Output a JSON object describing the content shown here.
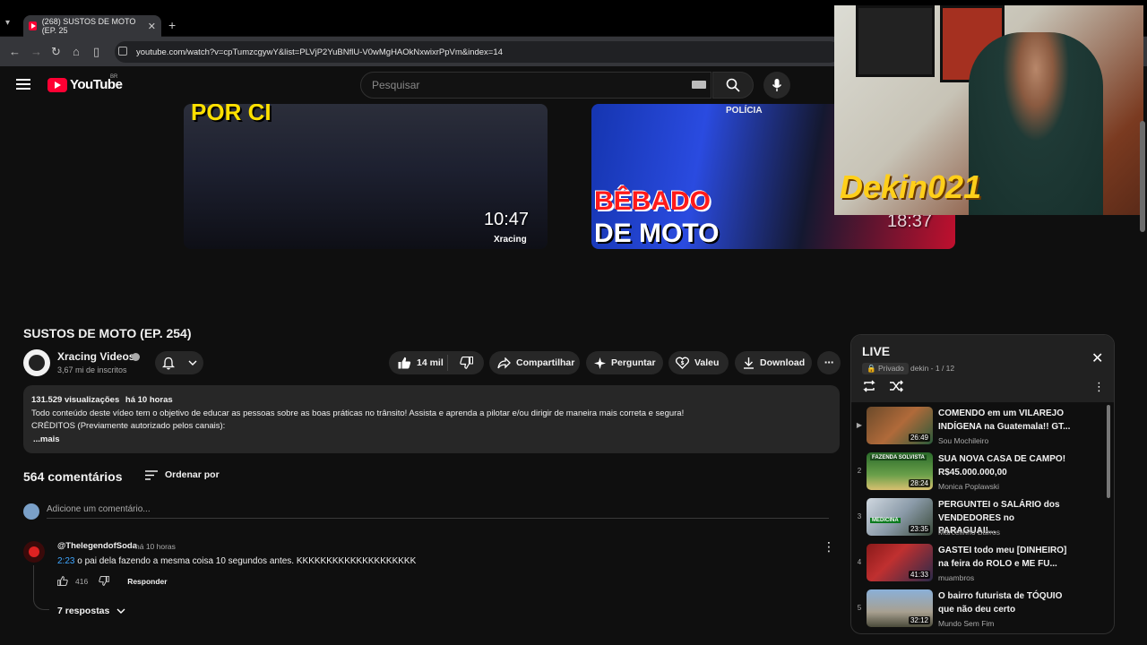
{
  "browser": {
    "tab_title": "(268) SUSTOS DE MOTO (EP. 25",
    "url": "youtube.com/watch?v=cpTumzcgywY&list=PLVjP2YuBNflU-V0wMgHAOkNxwixrPpVm&index=14"
  },
  "masthead": {
    "logo_text": "YouTube",
    "country": "BR",
    "search_placeholder": "Pesquisar"
  },
  "thumbnails": [
    {
      "title_text": "POR CI",
      "duration": "10:47",
      "brand": "Xracing"
    },
    {
      "title_line1": "BÊBADO",
      "title_line2": "DE MOTO",
      "duration": "18:37",
      "badge": "POLÍCIA"
    }
  ],
  "webcam": {
    "overlay_text": "Dekin021"
  },
  "video": {
    "title": "SUSTOS DE MOTO (EP. 254)",
    "channel": "Xracing Videos",
    "subscribers": "3,67 mi de inscritos",
    "likes": "14 mil",
    "share_label": "Compartilhar",
    "ask_label": "Perguntar",
    "valeu_label": "Valeu",
    "download_label": "Download"
  },
  "description": {
    "views": "131.529 visualizações",
    "time": "há 10 horas",
    "line1": "Todo conteúdo deste vídeo tem o objetivo de educar as pessoas sobre as boas práticas no trânsito! Assista e aprenda a pilotar e/ou dirigir de maneira mais correta e segura!",
    "line2": "CRÉDITOS (Previamente autorizado pelos canais):",
    "more": "...mais"
  },
  "comments": {
    "count_label": "564 comentários",
    "sort_label": "Ordenar por",
    "add_placeholder": "Adicione um comentário...",
    "items": [
      {
        "author": "@ThelegendofSoda",
        "time": "há 10 horas",
        "timestamp": "2:23",
        "text": " o pai dela fazendo a mesma coisa 10 segundos antes. KKKKKKKKKKKKKKKKKKKK",
        "likes": "416",
        "reply_label": "Responder",
        "replies_label": "7 respostas"
      }
    ]
  },
  "playlist": {
    "title": "LIVE",
    "privacy": "Privado",
    "meta": "dekin - 1 / 12",
    "items": [
      {
        "index": "▶",
        "title": "COMENDO em um VILAREJO INDÍGENA na Guatemala!! GT...",
        "channel": "Sou Mochileiro",
        "duration": "26:49",
        "label": ""
      },
      {
        "index": "2",
        "title": "SUA NOVA CASA DE CAMPO! R$45.000.000,00",
        "channel": "Monica Poplawski",
        "duration": "28:24",
        "label": "FAZENDA SOLVISTA"
      },
      {
        "index": "3",
        "title": "PERGUNTEI o SALÁRIO dos VENDEDORES no PARAGUAI!...",
        "channel": "Marcelinho Barros",
        "duration": "23:35",
        "label": "MEDICINA"
      },
      {
        "index": "4",
        "title": "GASTEI todo meu [DINHEIRO] na feira do ROLO e ME FU...",
        "channel": "muambros",
        "duration": "41:33",
        "label": ""
      },
      {
        "index": "5",
        "title": "O bairro futurista de TÓQUIO que não deu certo",
        "channel": "Mundo Sem Fim",
        "duration": "32:12",
        "label": ""
      }
    ]
  },
  "colors": {
    "accent_red": "#ff0033",
    "link_blue": "#3ea6ff",
    "pill_bg": "#272727"
  }
}
